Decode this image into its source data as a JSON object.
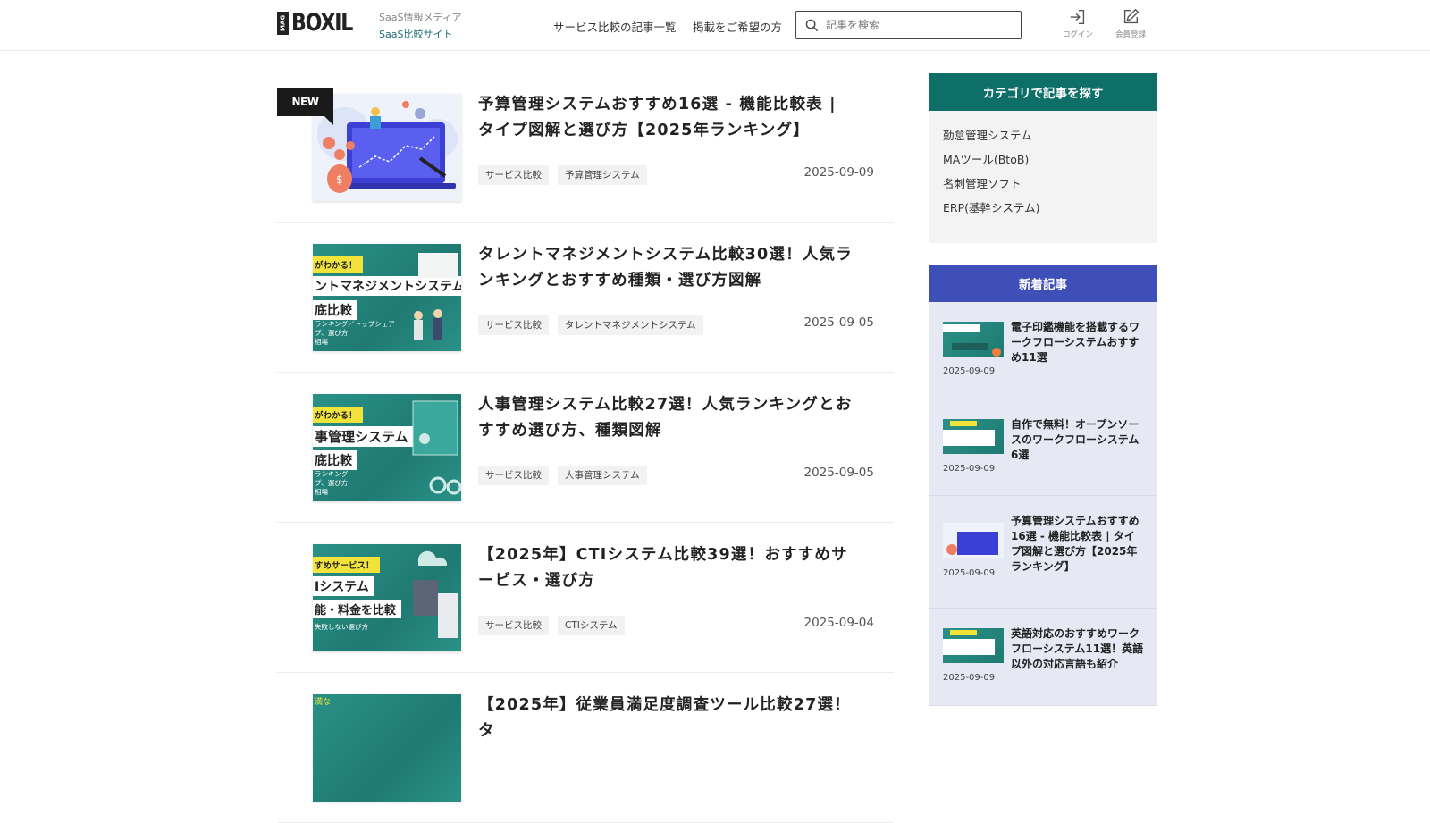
{
  "header": {
    "logo_mag": "MAG",
    "logo_text": "BOXIL",
    "tagline_1": "SaaS情報メディア",
    "tagline_2": "SaaS比較サイト",
    "nav": [
      "サービス比較の記事一覧",
      "掲載をご希望の方"
    ],
    "search_placeholder": "記事を検索",
    "login_label": "ログイン",
    "register_label": "会員登録"
  },
  "articles": [
    {
      "badge": "NEW",
      "title": "予算管理システムおすすめ16選 - 機能比較表 | タイプ図解と選び方【2025年ランキング】",
      "tags": [
        "サービス比較",
        "予算管理システム"
      ],
      "date": "2025-09-09"
    },
    {
      "title": "タレントマネジメントシステム比較30選！人気ランキングとおすすめ種類・選び方図解",
      "tags": [
        "サービス比較",
        "タレントマネジメントシステム"
      ],
      "date": "2025-09-05",
      "thumb": {
        "yellow": "がわかる！",
        "big": "ントマネジメントシステム",
        "big2": "底比較",
        "small": [
          "ランキング／トップシェア",
          "プ、選び方",
          "相場"
        ]
      }
    },
    {
      "title": "人事管理システム比較27選！人気ランキングとおすすめ選び方、種類図解",
      "tags": [
        "サービス比較",
        "人事管理システム"
      ],
      "date": "2025-09-05",
      "thumb": {
        "yellow": "がわかる！",
        "big": "事管理システム",
        "big2": "底比較",
        "small": [
          "ランキング",
          "プ、選び方",
          "相場"
        ]
      }
    },
    {
      "title": "【2025年】CTIシステム比較39選！おすすめサービス・選び方",
      "tags": [
        "サービス比較",
        "CTIシステム"
      ],
      "date": "2025-09-04",
      "thumb": {
        "yellow": "すめサービス！",
        "big": "Iシステム",
        "big2": "能・料金を比較",
        "small": [
          "失敗しない選び方"
        ]
      }
    },
    {
      "title": "【2025年】従業員満足度調査ツール比較27選！タ",
      "tags": [],
      "date": "",
      "thumb": {
        "yellow": "",
        "big": "",
        "big2": "",
        "small": [
          "満な"
        ]
      }
    }
  ],
  "sidebar": {
    "category_heading": "カテゴリで記事を探す",
    "category_color": "#0e6e68",
    "categories": [
      "勤怠管理システム",
      "MAツール(BtoB)",
      "名刺管理ソフト",
      "ERP(基幹システム)"
    ],
    "new_heading": "新着記事",
    "new_color": "#3f4fb8",
    "new_articles": [
      {
        "title": "電子印鑑機能を搭載するワークフローシステムおすすめ11選",
        "date": "2025-09-09"
      },
      {
        "title": "自作で無料！オープンソースのワークフローシステム6選",
        "date": "2025-09-09"
      },
      {
        "title": "予算管理システムおすすめ16選 - 機能比較表 | タイプ図解と選び方【2025年ランキング】",
        "date": "2025-09-09"
      },
      {
        "title": "英語対応のおすすめワークフローシステム11選！英語以外の対応言語も紹介",
        "date": "2025-09-09"
      }
    ]
  }
}
